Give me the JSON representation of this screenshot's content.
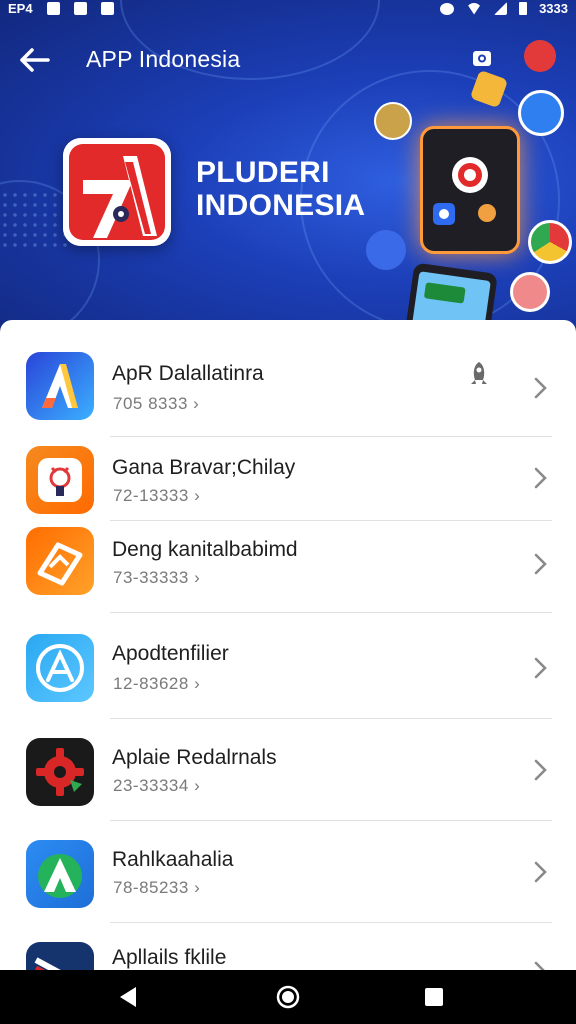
{
  "status_bar": {
    "left_text": "EP4",
    "time": "3333"
  },
  "app_bar": {
    "title": "APP Indonesia",
    "back_icon": "arrow-left-icon",
    "camera_icon": "camera-icon"
  },
  "promo": {
    "line1": "PLUDERI",
    "line2": "INDONESIA"
  },
  "apps": [
    {
      "name": "ApR Dalallatinra",
      "meta": "705 8333",
      "icon_colors": [
        "#2a44d8",
        "#3bb0ff"
      ],
      "badge": "rocket-icon"
    },
    {
      "name": "Gana Bravar;Chilay",
      "meta": "72-13333",
      "icon_colors": [
        "#f58a1f",
        "#ff6a00"
      ]
    },
    {
      "name": "Deng kanitalbabimd",
      "meta": "73-33333",
      "icon_colors": [
        "#ff6d00",
        "#ffa22b"
      ]
    },
    {
      "name": "Apodtenfilier",
      "meta": "12-83628",
      "icon_colors": [
        "#2aa8f2",
        "#5cc7ff"
      ]
    },
    {
      "name": "Aplaie Redalrnals",
      "meta": "23-33334",
      "icon_colors": [
        "#1a1a1a",
        "#d92626"
      ]
    },
    {
      "name": "Rahlkaahalia",
      "meta": "78-85233",
      "icon_colors": [
        "#2c8cf2",
        "#24b35a"
      ]
    },
    {
      "name": "Apllails fklile",
      "meta": "",
      "icon_colors": [
        "#15346e",
        "#d82828"
      ]
    }
  ],
  "nav": {
    "back": "nav-back-icon",
    "home": "nav-home-icon",
    "recents": "nav-recents-icon"
  }
}
